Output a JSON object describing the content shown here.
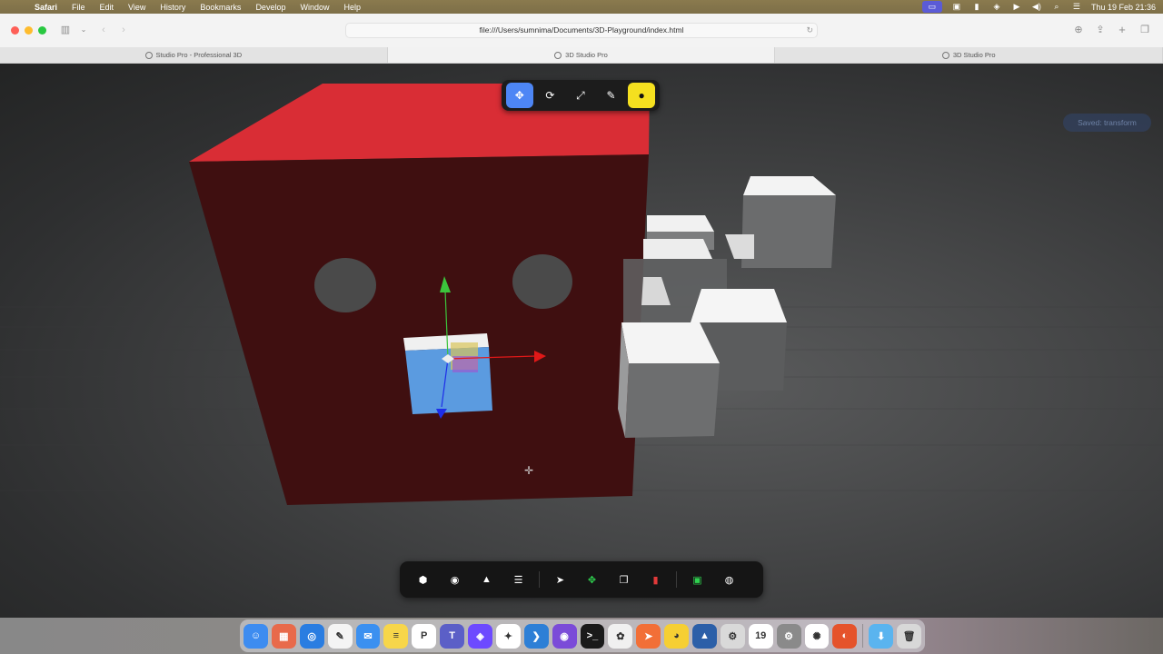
{
  "menubar": {
    "apple_icon": "apple-logo",
    "app_name": "Safari",
    "items": [
      "File",
      "Edit",
      "View",
      "History",
      "Bookmarks",
      "Develop",
      "Window",
      "Help"
    ],
    "datetime": "Thu 19 Feb  21:36"
  },
  "browser": {
    "address": "file:///Users/sumnima/Documents/3D-Playground/index.html",
    "tabs": [
      {
        "label": "Studio Pro - Professional 3D"
      },
      {
        "label": "3D Studio Pro"
      },
      {
        "label": "3D Studio Pro"
      }
    ],
    "active_tab_index": 1
  },
  "viewport": {
    "toast": "Saved: transform",
    "top_tools": [
      {
        "name": "move",
        "icon": "move-icon",
        "active": true
      },
      {
        "name": "rotate",
        "icon": "rotate-icon"
      },
      {
        "name": "scale",
        "icon": "scale-icon"
      },
      {
        "name": "paint",
        "icon": "brush-icon"
      },
      {
        "name": "light",
        "icon": "bulb-icon",
        "highlight": "#f5e01f"
      }
    ],
    "bottom_tools": [
      {
        "name": "add-cube",
        "icon": "cube-icon"
      },
      {
        "name": "add-sphere",
        "icon": "sphere-icon"
      },
      {
        "name": "add-cone",
        "icon": "cone-icon"
      },
      {
        "name": "add-cylinder",
        "icon": "cylinder-icon"
      },
      {
        "name": "select",
        "icon": "pointer-icon"
      },
      {
        "name": "move",
        "icon": "move-icon",
        "color": "#2fd14f"
      },
      {
        "name": "duplicate",
        "icon": "duplicate-icon"
      },
      {
        "name": "delete",
        "icon": "trash-icon",
        "color": "#e23a3a"
      },
      {
        "name": "save",
        "icon": "save-icon",
        "color": "#2fd14f"
      },
      {
        "name": "screenshot",
        "icon": "camera-icon"
      }
    ],
    "colors": {
      "big_cube_top": "#d92d35",
      "big_cube_face": "#3f0f10",
      "selected_cube": "#5b9be0",
      "axis_x": "#e01818",
      "axis_y": "#3cc43c",
      "axis_z": "#1e2ee8"
    }
  },
  "dock": {
    "apps": [
      {
        "name": "Finder",
        "color": "#3d8cf0",
        "glyph": "☺"
      },
      {
        "name": "Launchpad",
        "color": "#e86a4b",
        "glyph": "▦"
      },
      {
        "name": "Safari",
        "color": "#2a7de1",
        "glyph": "◎"
      },
      {
        "name": "Freeform",
        "color": "#f4f4f4",
        "glyph": "✎"
      },
      {
        "name": "Mail",
        "color": "#3b90f0",
        "glyph": "✉"
      },
      {
        "name": "Notes",
        "color": "#f7d64a",
        "glyph": "≡"
      },
      {
        "name": "Pages",
        "color": "#ffffff",
        "glyph": "P"
      },
      {
        "name": "Teams",
        "color": "#5b5fc7",
        "glyph": "T"
      },
      {
        "name": "Proton VPN",
        "color": "#6d4aff",
        "glyph": "◈"
      },
      {
        "name": "Bluesky",
        "color": "#ffffff",
        "glyph": "✦"
      },
      {
        "name": "VS Code",
        "color": "#2d7fd6",
        "glyph": "❯"
      },
      {
        "name": "Siri",
        "color": "#7b4bd8",
        "glyph": "◉"
      },
      {
        "name": "Terminal",
        "color": "#1a1a1a",
        "glyph": ">_"
      },
      {
        "name": "Photos",
        "color": "#f0f0f0",
        "glyph": "✿"
      },
      {
        "name": "Swift Playgrounds",
        "color": "#f26f37",
        "glyph": "➤"
      },
      {
        "name": "Cyberduck",
        "color": "#f6cf33",
        "glyph": "◕"
      },
      {
        "name": "Instruments",
        "color": "#2c5fa8",
        "glyph": "▲"
      },
      {
        "name": "Preview",
        "color": "#d9d9d9",
        "glyph": "⚙"
      },
      {
        "name": "Calendar",
        "color": "#ffffff",
        "glyph": "19"
      },
      {
        "name": "System Settings",
        "color": "#8a8a8a",
        "glyph": "⚙"
      },
      {
        "name": "ChatGPT",
        "color": "#ffffff",
        "glyph": "✺"
      },
      {
        "name": "Firefox",
        "color": "#e5532b",
        "glyph": "◐"
      },
      {
        "name": "Downloads",
        "color": "#5ab4ef",
        "glyph": "⬇"
      },
      {
        "name": "Trash",
        "color": "#d8d8d8",
        "glyph": "🗑"
      }
    ]
  }
}
